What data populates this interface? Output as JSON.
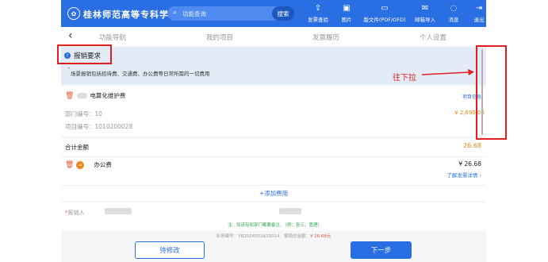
{
  "header": {
    "school_name": "桂林师范高等专科学校",
    "search_placeholder": "功能查询",
    "search_button": "搜索",
    "tools": [
      {
        "icon": "upload-icon",
        "glyph": "⇪",
        "label": "发票查验"
      },
      {
        "icon": "image-icon",
        "glyph": "▣",
        "label": "图片"
      },
      {
        "icon": "folder-icon",
        "glyph": "▭",
        "label": "版文件(PDF/OFD)"
      },
      {
        "icon": "mail-icon",
        "glyph": "✉",
        "label": "邮箱导入"
      },
      {
        "icon": "chat-icon",
        "glyph": "◌",
        "label": "消息"
      },
      {
        "icon": "exit-icon",
        "glyph": "⇥",
        "label": "退出"
      }
    ]
  },
  "nav": {
    "tabs": [
      "功能导航",
      "我的项目",
      "发票履历",
      "个人设置"
    ]
  },
  "notice": {
    "title": "报销要求",
    "text": "场景报销包括招待费、交通费、办公费等日常所需的一切费用"
  },
  "project": {
    "name": "电算化维护费",
    "tag": "项目信息",
    "dept_label": "部门编号：10",
    "code_label": "项目编号：1010200028",
    "amount": "¥ 2,690.00"
  },
  "totals": {
    "label": "合计金额",
    "value": "26.68",
    "fee_name": "办公费",
    "fee_value": "¥ 26.68",
    "detail_link": "了解发票详情 ›"
  },
  "add_fee": "+添加费用",
  "applicant": {
    "label": "报销人",
    "hint": "注：如该有权部门都要备注, （例：张三，管理）"
  },
  "footer": {
    "serial": "业务编号：YB2024051610014",
    "amount_label": "报销总金额：",
    "amount_value": "¥ 26.68元",
    "modify_button": "待修改",
    "next_button": "下一步"
  },
  "annotation": {
    "label": "往下拉",
    "color": "#e02020"
  },
  "colors": {
    "primary": "#2a6ee3",
    "accent_orange": "#e8891c",
    "notice_bg": "#e3ebf7"
  }
}
